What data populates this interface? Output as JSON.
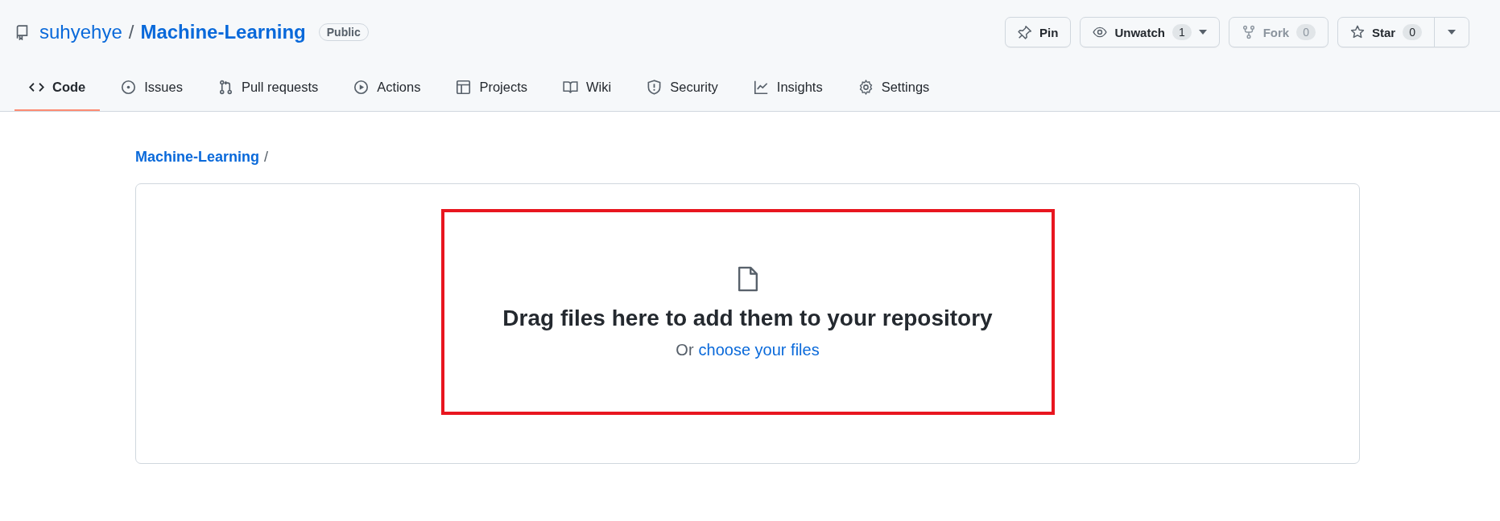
{
  "repo": {
    "owner": "suhyehye",
    "separator": "/",
    "name": "Machine-Learning",
    "visibility": "Public"
  },
  "actions": [
    {
      "kind": "pin",
      "label": "Pin",
      "dropdown": false,
      "disabled": false
    },
    {
      "kind": "watch",
      "label": "Unwatch",
      "count": "1",
      "dropdown": true,
      "disabled": false
    },
    {
      "kind": "fork",
      "label": "Fork",
      "count": "0",
      "dropdown": false,
      "disabled": true
    },
    {
      "kind": "star",
      "label": "Star",
      "count": "0",
      "dropdown": true,
      "disabled": false
    }
  ],
  "tabs": [
    {
      "kind": "code",
      "label": "Code",
      "selected": true
    },
    {
      "kind": "issues",
      "label": "Issues",
      "selected": false
    },
    {
      "kind": "pull",
      "label": "Pull requests",
      "selected": false
    },
    {
      "kind": "actions",
      "label": "Actions",
      "selected": false
    },
    {
      "kind": "projects",
      "label": "Projects",
      "selected": false
    },
    {
      "kind": "wiki",
      "label": "Wiki",
      "selected": false
    },
    {
      "kind": "security",
      "label": "Security",
      "selected": false
    },
    {
      "kind": "insights",
      "label": "Insights",
      "selected": false
    },
    {
      "kind": "settings",
      "label": "Settings",
      "selected": false
    }
  ],
  "breadcrumb": {
    "repo": "Machine-Learning",
    "separator": "/"
  },
  "dropzone": {
    "heading": "Drag files here to add them to your repository",
    "prefix": "Or",
    "link": "choose your files"
  }
}
